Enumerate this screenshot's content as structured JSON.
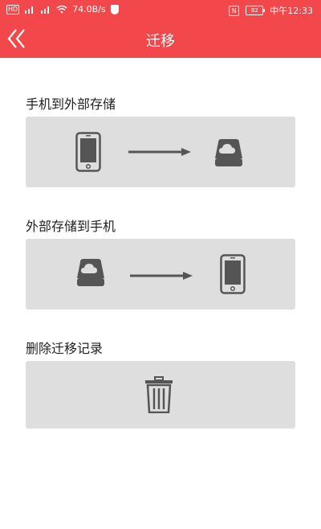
{
  "status_bar": {
    "network_speed": "74.0B/s",
    "battery": "82",
    "time": "中午12:33"
  },
  "app_bar": {
    "title": "迁移"
  },
  "sections": [
    {
      "label": "手机到外部存储"
    },
    {
      "label": "外部存储到手机"
    },
    {
      "label": "删除迁移记录"
    }
  ],
  "icons": {
    "back": "double-chevron-left-icon",
    "phone": "phone-icon",
    "arrow": "arrow-right-icon",
    "storage": "cloud-storage-icon",
    "trash": "trash-icon"
  },
  "colors": {
    "header": "#f2474b",
    "card": "#dedede",
    "icon": "#555555"
  }
}
